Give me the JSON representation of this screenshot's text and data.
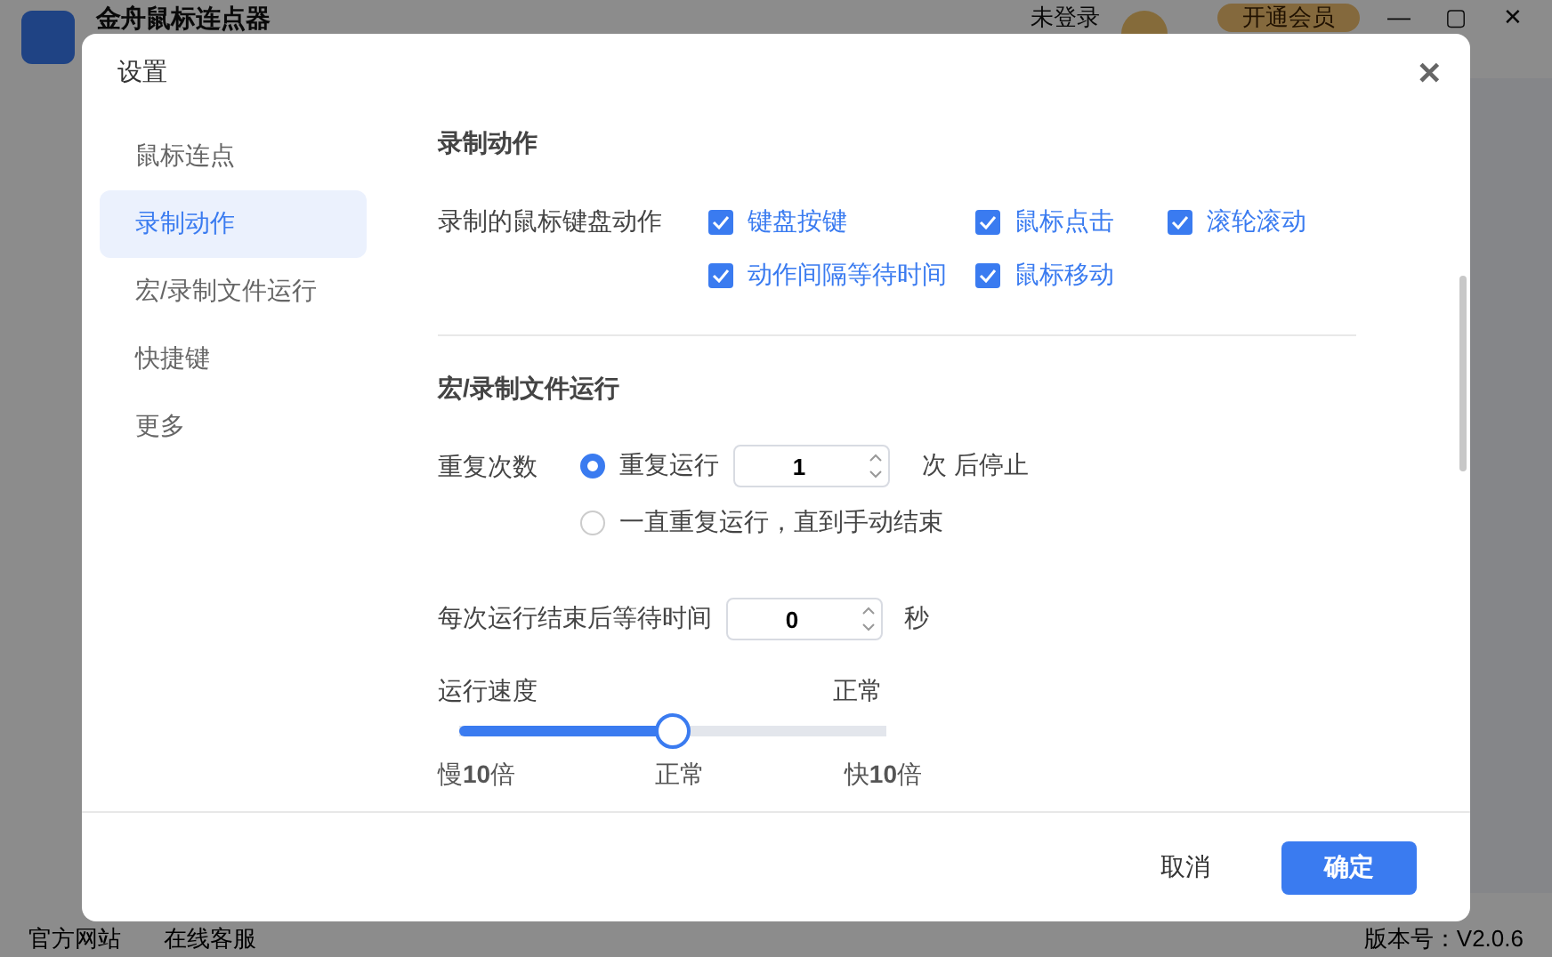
{
  "app": {
    "title": "金舟鼠标连点器",
    "login": "未登录",
    "vip_button": "开通会员",
    "window_controls": [
      "―",
      "▢",
      "✕"
    ],
    "footer_links": [
      "官方网站",
      "在线客服"
    ],
    "version": "版本号：V2.0.6"
  },
  "dialog": {
    "title": "设置",
    "close": "✕",
    "nav": [
      {
        "label": "鼠标连点",
        "selected": false
      },
      {
        "label": "录制动作",
        "selected": true
      },
      {
        "label": "宏/录制文件运行",
        "selected": false
      },
      {
        "label": "快捷键",
        "selected": false
      },
      {
        "label": "更多",
        "selected": false
      }
    ],
    "record": {
      "title": "录制动作",
      "label": "录制的鼠标键盘动作",
      "options": [
        {
          "label": "键盘按键",
          "checked": true
        },
        {
          "label": "鼠标点击",
          "checked": true
        },
        {
          "label": "滚轮滚动",
          "checked": true
        },
        {
          "label": "动作间隔等待时间",
          "checked": true
        },
        {
          "label": "鼠标移动",
          "checked": true
        }
      ]
    },
    "run": {
      "title": "宏/录制文件运行",
      "repeat_label": "重复次数",
      "repeat_options": [
        {
          "label": "重复运行",
          "selected": true,
          "value": "1",
          "suffix": "次 后停止"
        },
        {
          "label": "一直重复运行，直到手动结束",
          "selected": false
        }
      ],
      "wait_label": "每次运行结束后等待时间",
      "wait_value": "0",
      "wait_unit": "秒",
      "speed": {
        "label": "运行速度",
        "reading": "正常",
        "level": 0.5
      },
      "speed_ticks": [
        "慢**10**倍",
        "正常",
        "快**10**倍"
      ]
    },
    "buttons": [
      {
        "label": "取消",
        "kind": "secondary"
      },
      {
        "label": "确定",
        "kind": "primary"
      }
    ]
  }
}
